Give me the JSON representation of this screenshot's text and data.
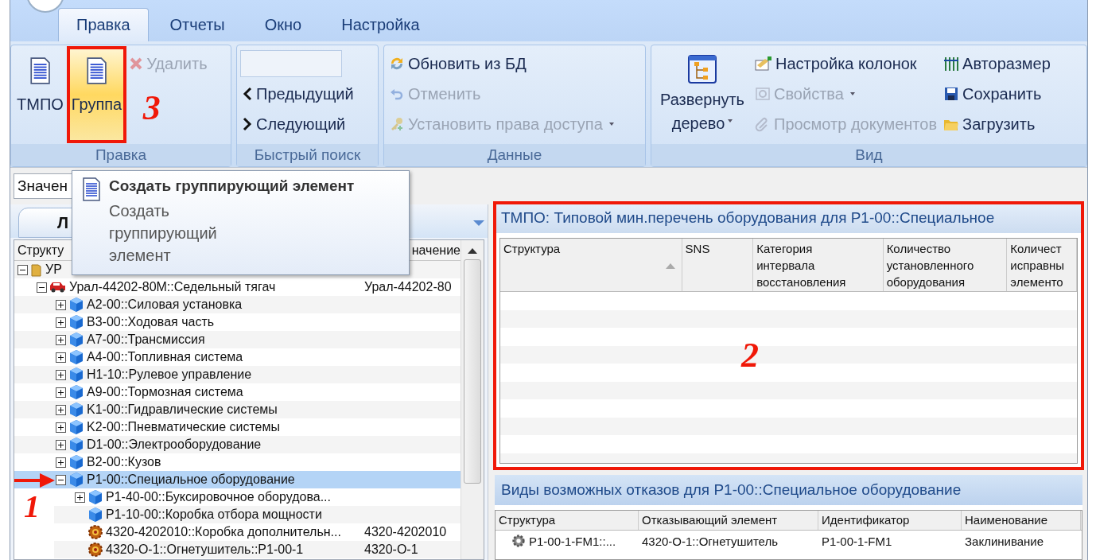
{
  "app_tabs": [
    {
      "label": "Правка",
      "selected": true
    },
    {
      "label": "Отчеты",
      "selected": false
    },
    {
      "label": "Окно",
      "selected": false
    },
    {
      "label": "Настройка",
      "selected": false
    }
  ],
  "edit_group": {
    "label": "Правка",
    "large_buttons": [
      {
        "label": "ТМПО",
        "hovered": false
      },
      {
        "label": "Группа",
        "hovered": true,
        "annotation": "3"
      }
    ],
    "delete_button": {
      "label": "Удалить",
      "disabled": true
    }
  },
  "search_group": {
    "label": "Быстрый поиск",
    "prev_button": "Предыдущий",
    "next_button": "Следующий"
  },
  "data_group": {
    "label": "Данные",
    "buttons": [
      {
        "label": "Обновить из БД",
        "disabled": false,
        "dropdown": false
      },
      {
        "label": "Отменить",
        "disabled": true,
        "dropdown": false
      },
      {
        "label": "Установить права доступа",
        "disabled": true,
        "dropdown": true
      }
    ]
  },
  "view_group": {
    "label": "Вид",
    "expand_button": {
      "label": "Развернуть дерево",
      "dropdown": true
    },
    "columns": [
      [
        {
          "label": "Настройка колонок",
          "disabled": false,
          "dropdown": false
        },
        {
          "label": "Свойства",
          "disabled": true,
          "dropdown": true
        },
        {
          "label": "Просмотр документов",
          "disabled": true,
          "dropdown": false
        }
      ],
      [
        {
          "label": "Авторазмер",
          "disabled": false,
          "dropdown": false
        },
        {
          "label": "Сохранить",
          "disabled": false,
          "dropdown": false
        },
        {
          "label": "Загрузить",
          "disabled": false,
          "dropdown": false
        }
      ]
    ]
  },
  "filter_field": {
    "value": "Значен"
  },
  "tooltip": {
    "title": "Создать группирующий элемент",
    "description": "Создать группирующий элемент"
  },
  "left_panel": {
    "tab": "Л",
    "tree_columns": [
      "Структу",
      "начение"
    ],
    "tree": [
      {
        "label": "УР",
        "kind": "folder",
        "expanded": true,
        "selected": false,
        "children": [
          {
            "label": "Урал-44202-80М::Седельный тягач",
            "value": "Урал-44202-80",
            "kind": "vehicle",
            "expanded": true,
            "selected": false,
            "children": [
              {
                "label": "A2-00::Силовая установка",
                "kind": "assembly",
                "expanded": false,
                "selected": false
              },
              {
                "label": "B3-00::Ходовая часть",
                "kind": "assembly",
                "expanded": false,
                "selected": false
              },
              {
                "label": "A7-00::Трансмиссия",
                "kind": "assembly",
                "expanded": false,
                "selected": false
              },
              {
                "label": "A4-00::Топливная система",
                "kind": "assembly",
                "expanded": false,
                "selected": false
              },
              {
                "label": "H1-10::Рулевое управление",
                "kind": "assembly",
                "expanded": false,
                "selected": false
              },
              {
                "label": "A9-00::Тормозная система",
                "kind": "assembly",
                "expanded": false,
                "selected": false
              },
              {
                "label": "K1-00::Гидравлические системы",
                "kind": "assembly",
                "expanded": false,
                "selected": false
              },
              {
                "label": "K2-00::Пневматические системы",
                "kind": "assembly",
                "expanded": false,
                "selected": false
              },
              {
                "label": "D1-00::Электрооборудование",
                "kind": "assembly",
                "expanded": false,
                "selected": false
              },
              {
                "label": "B2-00::Кузов",
                "kind": "assembly",
                "expanded": false,
                "selected": false
              },
              {
                "label": "P1-00::Специальное оборудование",
                "kind": "assembly",
                "expanded": true,
                "selected": true,
                "annotation": "1",
                "children": [
                  {
                    "label": "P1-40-00::Буксировочное оборудова...",
                    "kind": "assembly",
                    "expanded": false,
                    "selected": false
                  },
                  {
                    "label": "P1-10-00::Коробка отбора мощности",
                    "kind": "assembly",
                    "selected": false
                  },
                  {
                    "label": "4320-4202010::Коробка дополнительн...",
                    "value": "4320-4202010",
                    "kind": "component",
                    "selected": false
                  },
                  {
                    "label": "4320-О-1::Огнетушитель::P1-00-1",
                    "value": "4320-О-1",
                    "kind": "component",
                    "selected": false
                  }
                ]
              }
            ]
          }
        ]
      }
    ]
  },
  "tmpo_panel": {
    "title": "ТМПО: Типовой мин.перечень оборудования для P1-00::Специальное",
    "annotation": "2",
    "columns": [
      {
        "label": "Структура",
        "sorted": true
      },
      {
        "label": "SNS",
        "sorted": false
      },
      {
        "label": "Категория интервала восстановления",
        "sorted": false
      },
      {
        "label": "Количество установленного оборудования",
        "sorted": false
      },
      {
        "label": "Количест исправны элементо",
        "sorted": false
      }
    ]
  },
  "failures_panel": {
    "title": "Виды возможных отказов для P1-00::Специальное оборудование",
    "columns": [
      "Структура",
      "Отказывающий элемент",
      "Идентификатор",
      "Наименование"
    ],
    "rows": [
      {
        "cells": [
          "P1-00-1-FM1::...",
          "4320-О-1::Огнетушитель",
          "P1-00-1-FM1",
          "Заклинивание"
        ]
      }
    ]
  }
}
